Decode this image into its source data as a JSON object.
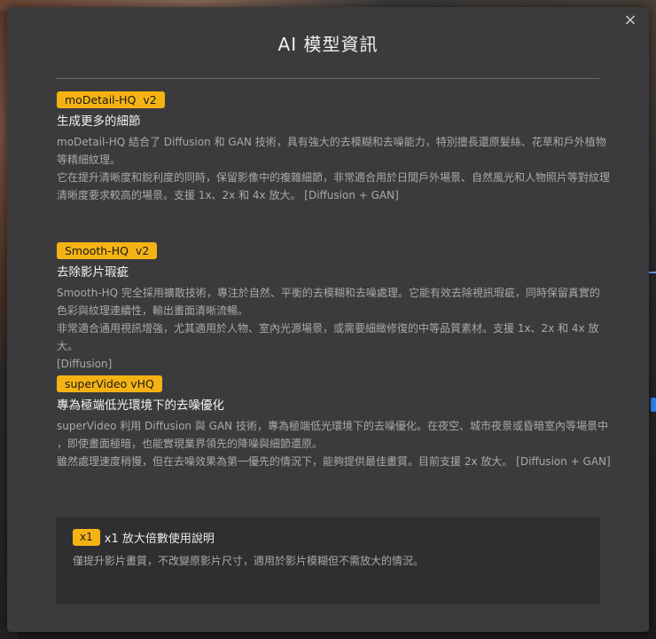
{
  "dialog": {
    "title": "AI 模型資訊",
    "close_label": "×"
  },
  "models": [
    {
      "badge": "moDetail-HQ  v2",
      "heading": "生成更多的細節",
      "lines": [
        "moDetail-HQ 結合了 Diffusion 和 GAN 技術，具有強大的去模糊和去噪能力，特別擅長還原髮絲、花草和戶外植物",
        "等精細紋理。",
        "它在提升清晰度和銳利度的同時，保留影像中的複雜細節，非常適合用於日間戶外場景、自然風光和人物照片等對紋理",
        "清晰度要求較高的場景。支援 1x、2x 和 4x 放大。 [Diffusion + GAN]"
      ]
    },
    {
      "badge": "Smooth-HQ  v2",
      "heading": "去除影片瑕疵",
      "lines": [
        "Smooth-HQ 完全採用擴散技術，專注於自然、平衡的去模糊和去噪處理。它能有效去除視訊瑕疵，同時保留真實的",
        "色彩與紋理連續性，輸出畫面清晰流暢。",
        "非常適合通用視訊增強，尤其適用於人物、室內光源場景，或需要細緻修復的中等品質素材。支援 1x、2x 和 4x 放大。",
        "[Diffusion]"
      ]
    },
    {
      "badge": "superVideo vHQ",
      "heading": "專為極端低光環境下的去噪優化",
      "lines": [
        "superVideo 利用 Diffusion 與 GAN 技術，專為極端低光環境下的去噪優化。在夜空、城市夜景或昏暗室內等場景中",
        "，即使畫面極暗，也能實現業界領先的降噪與細節還原。",
        "雖然處理速度稍慢，但在去噪效果為第一優先的情況下，能夠提供最佳畫質。目前支援 2x 放大。 [Diffusion + GAN]"
      ]
    }
  ],
  "note": {
    "badge": "x1",
    "title": "x1 放大倍數使用說明",
    "desc": "僅提升影片畫質，不改變原影片尺寸，適用於影片模糊但不需放大的情況。"
  },
  "colors": {
    "badge_bg": "#f5b313",
    "dialog_bg": "#3b3b3d",
    "note_bg": "#2f2f31"
  }
}
